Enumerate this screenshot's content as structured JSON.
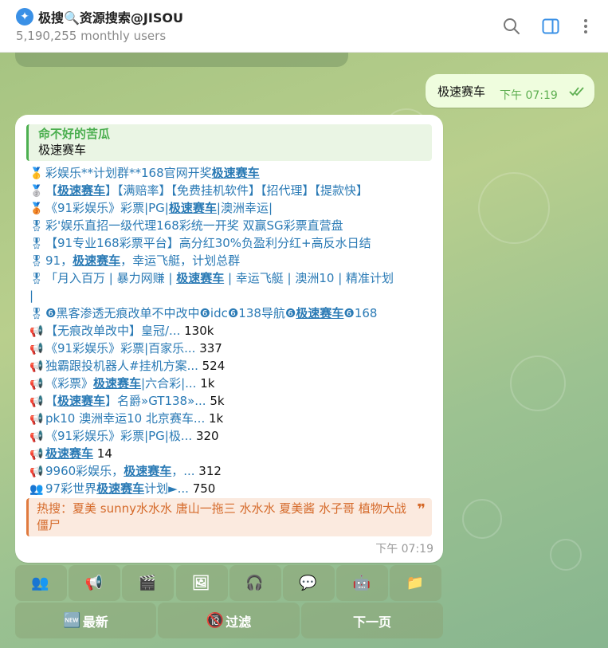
{
  "header": {
    "title": "极搜🔍资源搜索@JISOU",
    "subtitle": "5,190,255 monthly users",
    "brand_color": "#3a90e6"
  },
  "outgoing": {
    "text": "极速赛车",
    "time": "下午 07:19"
  },
  "incoming": {
    "reply_name": "命不好的苦瓜",
    "reply_text": "极速赛车",
    "lines": [
      {
        "icon": "🥇",
        "segments": [
          {
            "t": "彩娱乐**计划群**168官网开奖",
            "b": false
          },
          {
            "t": "极速赛车",
            "b": true
          }
        ],
        "count": ""
      },
      {
        "icon": "🥈",
        "segments": [
          {
            "t": "【",
            "b": false
          },
          {
            "t": "极速赛车",
            "b": true
          },
          {
            "t": "】【满赔率】【免费挂机软件】【招代理】【提款快】",
            "b": false
          }
        ],
        "count": ""
      },
      {
        "icon": "🥉",
        "segments": [
          {
            "t": "《91彩娱乐》彩票|PG|",
            "b": false
          },
          {
            "t": "极速赛车",
            "b": true
          },
          {
            "t": "|澳洲幸运|",
            "b": false
          }
        ],
        "count": ""
      },
      {
        "icon": "🎖",
        "segments": [
          {
            "t": "彩'娱乐直招一级代理168彩统一开奖 双赢SG彩票直营盘",
            "b": false
          }
        ],
        "count": ""
      },
      {
        "icon": "🎖",
        "segments": [
          {
            "t": "【91专业168彩票平台】高分红30%负盈利分红+高反水日结",
            "b": false
          }
        ],
        "count": ""
      },
      {
        "icon": "🎖",
        "segments": [
          {
            "t": "91，",
            "b": false
          },
          {
            "t": "极速赛车",
            "b": true
          },
          {
            "t": "，幸运飞艇，计划总群",
            "b": false
          }
        ],
        "count": ""
      },
      {
        "icon": "🎖",
        "segments": [
          {
            "t": "「月入百万 | 暴力网赚 | ",
            "b": false
          },
          {
            "t": "极速赛车",
            "b": true
          },
          {
            "t": " | 幸运飞艇 | 澳洲10 | 精准计划",
            "b": false
          }
        ],
        "count": ""
      },
      {
        "icon": "",
        "segments": [
          {
            "t": "|",
            "b": false
          }
        ],
        "count": ""
      },
      {
        "icon": "🎖",
        "segments": [
          {
            "t": "❻黑客渗透无痕改单不中改中❻idc❻138导航❻",
            "b": false
          },
          {
            "t": "极速赛车",
            "b": true
          },
          {
            "t": "❻168",
            "b": false
          }
        ],
        "count": ""
      },
      {
        "icon": "📢",
        "segments": [
          {
            "t": "【无痕改单改中】皇冠/...",
            "b": false
          }
        ],
        "count": " 130k"
      },
      {
        "icon": "📢",
        "segments": [
          {
            "t": "《91彩娱乐》彩票|百家乐...",
            "b": false
          }
        ],
        "count": " 337"
      },
      {
        "icon": "📢",
        "segments": [
          {
            "t": "独霸跟投机器人#挂机方案...",
            "b": false
          }
        ],
        "count": " 524"
      },
      {
        "icon": "📢",
        "segments": [
          {
            "t": "《彩票》",
            "b": false
          },
          {
            "t": "极速赛车",
            "b": true
          },
          {
            "t": "|六合彩|...",
            "b": false
          }
        ],
        "count": " 1k"
      },
      {
        "icon": "📢",
        "segments": [
          {
            "t": "【",
            "b": false
          },
          {
            "t": "极速赛车",
            "b": true
          },
          {
            "t": "】名爵»GT138»...",
            "b": false
          }
        ],
        "count": " 5k"
      },
      {
        "icon": "📢",
        "segments": [
          {
            "t": "pk10 澳洲幸运10 北京赛车...",
            "b": false
          }
        ],
        "count": " 1k"
      },
      {
        "icon": "📢",
        "segments": [
          {
            "t": "《91彩娱乐》彩票|PG|极...",
            "b": false
          }
        ],
        "count": " 320"
      },
      {
        "icon": "📢",
        "segments": [
          {
            "t": "极速赛车",
            "b": true
          }
        ],
        "count": " 14"
      },
      {
        "icon": "📢",
        "segments": [
          {
            "t": "9960彩娱乐，",
            "b": false
          },
          {
            "t": "极速赛车",
            "b": true
          },
          {
            "t": "，...",
            "b": false
          }
        ],
        "count": " 312"
      },
      {
        "icon": "👥",
        "segments": [
          {
            "t": "97彩世界",
            "b": false
          },
          {
            "t": "极速赛车",
            "b": true
          },
          {
            "t": "计划►...",
            "b": false
          }
        ],
        "count": " 750"
      }
    ],
    "hot_text": "热搜：夏美 sunny水水水 唐山一拖三 水水水 夏美酱 水子哥 植物大战僵尸",
    "hot_quote": "❞",
    "time": "下午 07:19"
  },
  "keyboard": {
    "row1": [
      "👥",
      "📢",
      "🎬",
      "🖼",
      "🎧",
      "💬",
      "🤖",
      "📁"
    ],
    "row2": [
      {
        "emoji": "🆕",
        "label": "最新"
      },
      {
        "emoji": "🔞",
        "label": "过滤"
      },
      {
        "emoji": "",
        "label": "下一页"
      }
    ]
  }
}
